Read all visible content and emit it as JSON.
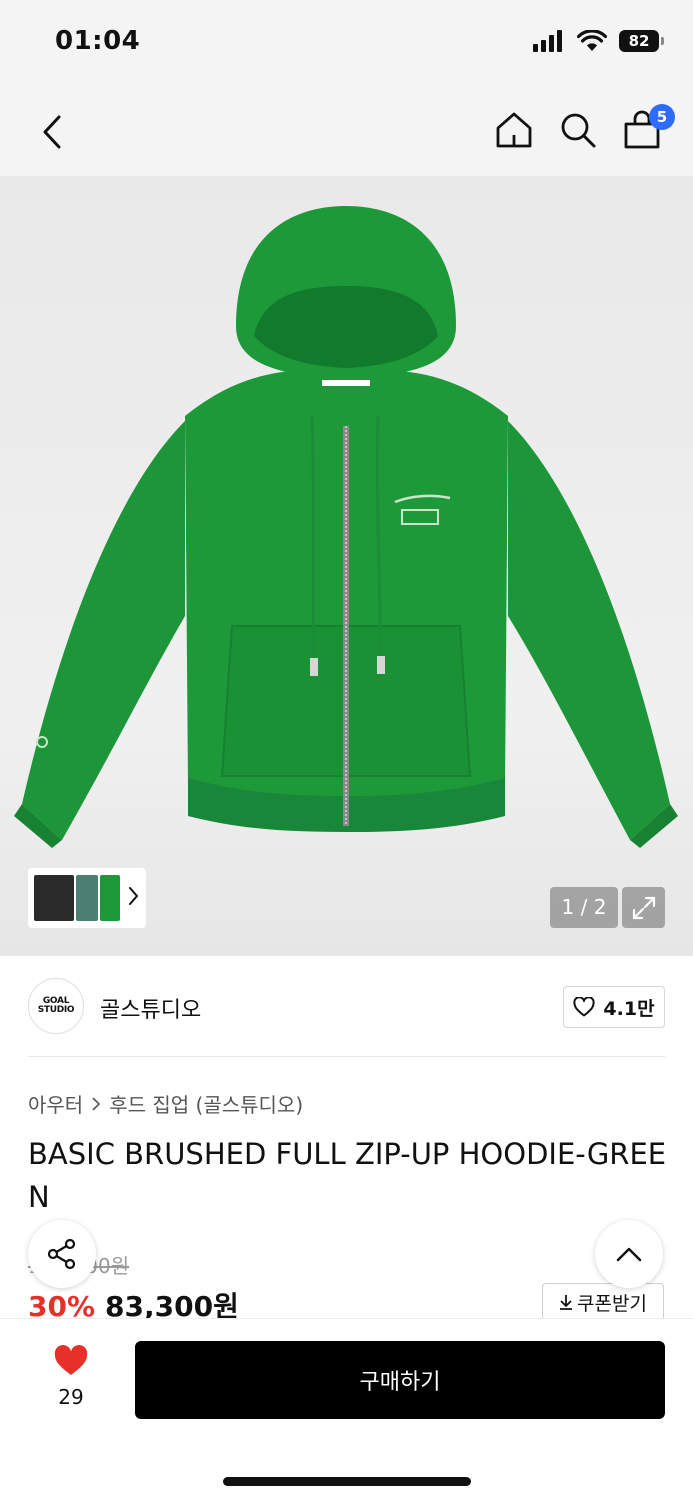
{
  "status_bar": {
    "time": "01:04",
    "battery": "82"
  },
  "nav": {
    "cart_count": "5",
    "icons": [
      "back-icon",
      "home-icon",
      "search-icon",
      "shopping-bag-icon"
    ]
  },
  "gallery": {
    "counter": "1 / 2",
    "product_color": "#1a9138"
  },
  "brand": {
    "logo_text": "GOAL STUDIO",
    "name": "골스튜디오",
    "likes": "4.1만"
  },
  "breadcrumb": {
    "category": "아우터",
    "subcategory": "후드 집업 (골스튜디오)"
  },
  "product": {
    "title": "BASIC BRUSHED FULL ZIP-UP HOODIE-GREEN",
    "original_price": "119,000원",
    "discount": "30%",
    "price": "83,300원",
    "coupon_label": "쿠폰받기"
  },
  "bottom_bar": {
    "wish_count": "29",
    "buy_label": "구매하기"
  },
  "colors": {
    "accent_red": "#e8302b",
    "badge_blue": "#2f6bff",
    "buy_button": "#000000"
  }
}
